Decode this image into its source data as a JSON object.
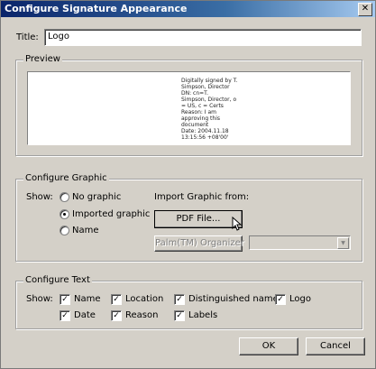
{
  "window": {
    "title": "Configure Signature Appearance",
    "close_glyph": "✕"
  },
  "title_field": {
    "label": "Title:",
    "value": "Logo"
  },
  "preview": {
    "legend": "Preview",
    "text": "Digitally signed by T.\nSimpson, Director\nDN: cn=T.\nSimpson, Director, o\n= US, c = Certs\nReason: I am\napproving this\ndocument\nDate: 2004.11.18\n13:15:56 +08'00'"
  },
  "configure_graphic": {
    "legend": "Configure Graphic",
    "show_label": "Show:",
    "options": [
      {
        "label": "No graphic",
        "selected": false
      },
      {
        "label": "Imported graphic",
        "selected": true
      },
      {
        "label": "Name",
        "selected": false
      }
    ],
    "import_label": "Import Graphic from:",
    "pdf_button": "PDF File...",
    "palm_button": "Palm(TM) Organizer",
    "palm_dropdown_value": ""
  },
  "configure_text": {
    "legend": "Configure Text",
    "show_label": "Show:",
    "items": [
      {
        "label": "Name",
        "checked": true
      },
      {
        "label": "Location",
        "checked": true
      },
      {
        "label": "Distinguished name",
        "checked": true
      },
      {
        "label": "Logo",
        "checked": true
      },
      {
        "label": "Date",
        "checked": true
      },
      {
        "label": "Reason",
        "checked": true
      },
      {
        "label": "Labels",
        "checked": true
      }
    ],
    "check_glyph": "✓"
  },
  "buttons": {
    "ok": "OK",
    "cancel": "Cancel"
  }
}
